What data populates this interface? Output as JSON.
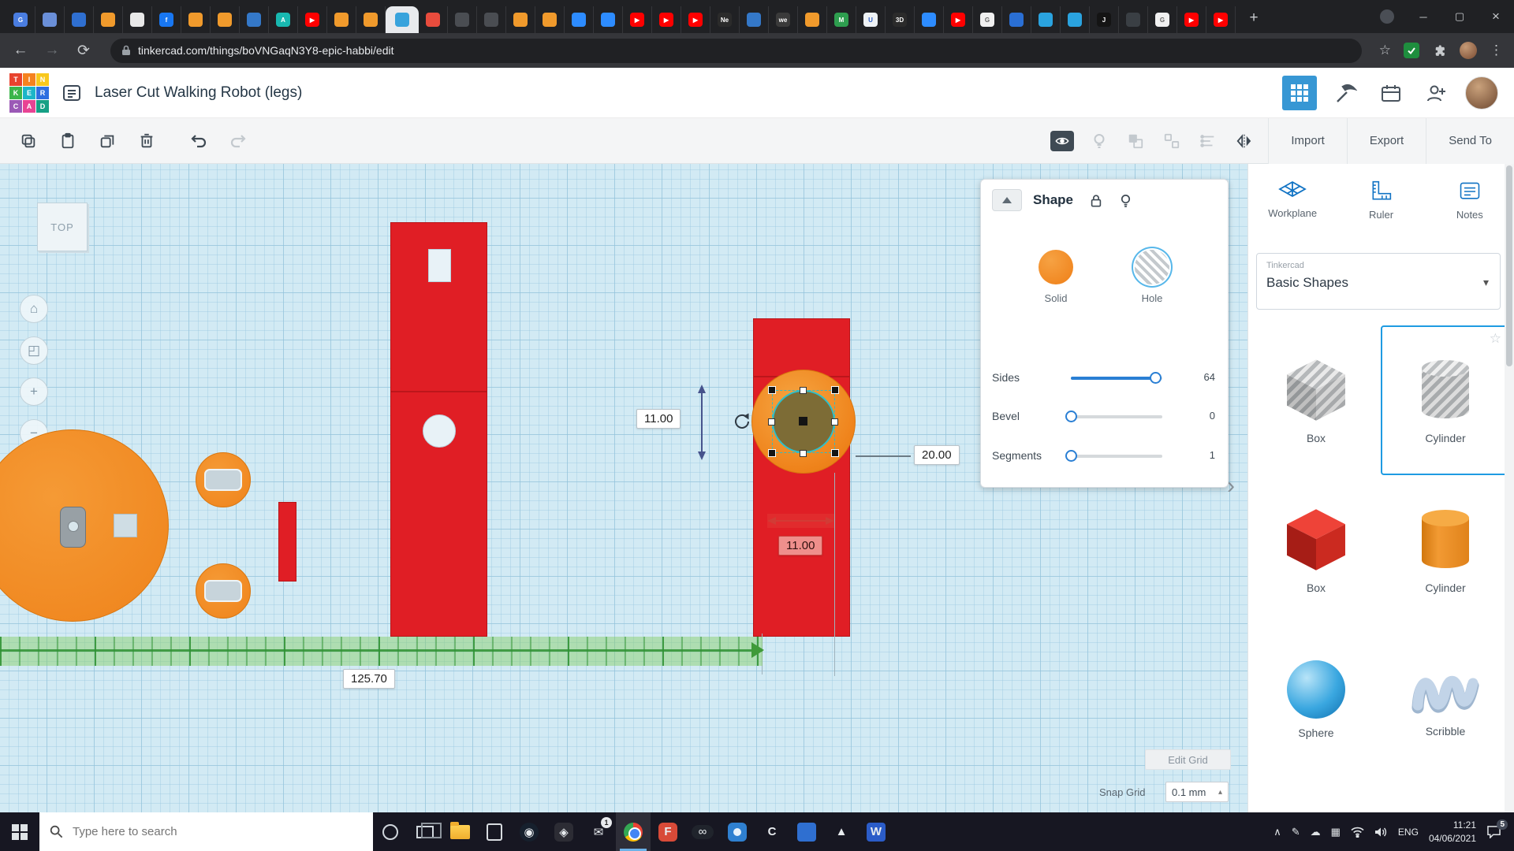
{
  "glyphs": {
    "newtab": "+",
    "minimize": "─",
    "maximize": "▢",
    "close": "×",
    "back": "←",
    "forward": "→",
    "reload": "⟳",
    "star": "☆",
    "kebab": "⋮",
    "caret_down": "▾",
    "caret_up": "▴",
    "chevron": "›",
    "star_outline": "☆"
  },
  "browser": {
    "url": "tinkercad.com/things/boVNGaqN3Y8-epic-habbi/edit",
    "tabs": [
      {
        "c": "#4a7de0",
        "g": "G"
      },
      {
        "c": "#6a8fd8",
        "g": ""
      },
      {
        "c": "#2f6fd0",
        "g": ""
      },
      {
        "c": "#f09a2c",
        "g": ""
      },
      {
        "c": "#e8e8e8",
        "g": ""
      },
      {
        "c": "#1877f2",
        "g": "f"
      },
      {
        "c": "#f09a2c",
        "g": ""
      },
      {
        "c": "#f09a2c",
        "g": ""
      },
      {
        "c": "#3478c8",
        "g": ""
      },
      {
        "c": "#18b8b0",
        "g": "A"
      },
      {
        "c": "#ff0000",
        "g": "▶"
      },
      {
        "c": "#f09a2c",
        "g": ""
      },
      {
        "c": "#f09a2c",
        "g": ""
      },
      {
        "c": "#38a3dc",
        "g": "",
        "active": true
      },
      {
        "c": "#e84c3d",
        "g": ""
      },
      {
        "c": "#4a4d52",
        "g": ""
      },
      {
        "c": "#4a4d52",
        "g": ""
      },
      {
        "c": "#f09a2c",
        "g": ""
      },
      {
        "c": "#f09a2c",
        "g": ""
      },
      {
        "c": "#2d8cff",
        "g": ""
      },
      {
        "c": "#2d8cff",
        "g": ""
      },
      {
        "c": "#ff0000",
        "g": "▶"
      },
      {
        "c": "#ff0000",
        "g": "▶"
      },
      {
        "c": "#ff0000",
        "g": "▶"
      },
      {
        "c": "#2b2b2b",
        "g": "Ne"
      },
      {
        "c": "#3478c8",
        "g": ""
      },
      {
        "c": "#3a3a3a",
        "g": "we"
      },
      {
        "c": "#f09a2c",
        "g": ""
      },
      {
        "c": "#2e9e4f",
        "g": "M"
      },
      {
        "c": "#eef2f5",
        "g": "U",
        "fg": "#2b5cc4"
      },
      {
        "c": "#2b2b2b",
        "g": "3D"
      },
      {
        "c": "#2d8cff",
        "g": ""
      },
      {
        "c": "#ff0000",
        "g": "▶"
      },
      {
        "c": "#f0f0f0",
        "g": "G",
        "fg": "#666666"
      },
      {
        "c": "#2a6fd4",
        "g": ""
      },
      {
        "c": "#2aa3df",
        "g": ""
      },
      {
        "c": "#2aa3df",
        "g": ""
      },
      {
        "c": "#141414",
        "g": "J"
      },
      {
        "c": "#3a3f44",
        "g": ""
      },
      {
        "c": "#f0f0f0",
        "g": "G",
        "fg": "#666666"
      },
      {
        "c": "#ff0000",
        "g": "▶"
      },
      {
        "c": "#ff0000",
        "g": "▶"
      }
    ]
  },
  "app_header": {
    "title": "Laser Cut Walking Robot (legs)",
    "logo": [
      {
        "t": "T",
        "c": "#e8432e"
      },
      {
        "t": "I",
        "c": "#f5821f"
      },
      {
        "t": "N",
        "c": "#f8c81c"
      },
      {
        "t": "K",
        "c": "#3bb54a"
      },
      {
        "t": "E",
        "c": "#1cb5c8"
      },
      {
        "t": "R",
        "c": "#2f6fe0"
      },
      {
        "t": "C",
        "c": "#9b59b6"
      },
      {
        "t": "A",
        "c": "#e84393"
      },
      {
        "t": "D",
        "c": "#16a085"
      }
    ]
  },
  "toolbar": {
    "import": "Import",
    "export": "Export",
    "send_to": "Send To"
  },
  "canvas": {
    "view_cube": "TOP",
    "nav": [
      "⌂",
      "◰",
      "+",
      "−",
      "◫"
    ],
    "dim_height": "11.00",
    "dim_diameter": "20.00",
    "dim_width": "11.00",
    "ruler_length": "125.70"
  },
  "shape_panel": {
    "title": "Shape",
    "solid_label": "Solid",
    "hole_label": "Hole",
    "sliders": [
      {
        "label": "Sides",
        "value": "64",
        "pos": 0.92
      },
      {
        "label": "Bevel",
        "value": "0",
        "pos": 0
      },
      {
        "label": "Segments",
        "value": "1",
        "pos": 0
      }
    ]
  },
  "sidebar": {
    "tools": [
      {
        "label": "Workplane"
      },
      {
        "label": "Ruler"
      },
      {
        "label": "Notes"
      }
    ],
    "library_label": "Tinkercad",
    "category": "Basic Shapes",
    "shapes": [
      {
        "label": "Box"
      },
      {
        "label": "Cylinder"
      },
      {
        "label": "Box"
      },
      {
        "label": "Cylinder"
      },
      {
        "label": "Sphere"
      },
      {
        "label": "Scribble"
      }
    ],
    "edit_grid": "Edit Grid",
    "snap_label": "Snap Grid",
    "snap_value": "0.1 mm"
  },
  "taskbar": {
    "search_placeholder": "Type here to search",
    "icons": [
      {
        "name": "cortana",
        "kind": "ring"
      },
      {
        "name": "task-view",
        "kind": "panes"
      },
      {
        "name": "file-explorer",
        "kind": "folder"
      },
      {
        "name": "store",
        "kind": "bag"
      },
      {
        "name": "steam",
        "kind": "steam",
        "glyph": "◉"
      },
      {
        "name": "game",
        "kind": "game",
        "glyph": "◈"
      },
      {
        "name": "mail",
        "kind": "mail",
        "glyph": "✉",
        "badge": "1"
      },
      {
        "name": "chrome",
        "kind": "chrome",
        "active": true
      },
      {
        "name": "filezilla",
        "kind": "ff",
        "glyph": "F"
      },
      {
        "name": "loop",
        "kind": "oval",
        "glyph": "∞"
      },
      {
        "name": "camera",
        "kind": "cam"
      },
      {
        "name": "c-app",
        "kind": "cletter",
        "glyph": "C"
      },
      {
        "name": "blue-app",
        "kind": "bluetile"
      },
      {
        "name": "acer",
        "kind": "tri",
        "glyph": "▲"
      },
      {
        "name": "word",
        "kind": "word",
        "glyph": "W"
      }
    ],
    "tray_glyphs": [
      "∧",
      "✎",
      "☁",
      "▦"
    ],
    "lang": "ENG",
    "time": "11:21",
    "date": "04/06/2021",
    "notif_count": "5"
  }
}
